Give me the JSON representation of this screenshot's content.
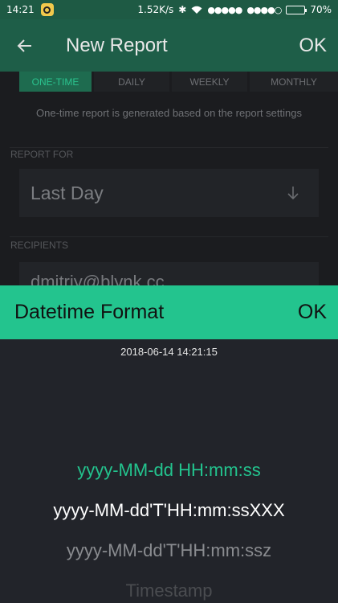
{
  "status_bar": {
    "time": "14:21",
    "speed": "1.52K/s",
    "signal_1": "●●●●●",
    "signal_2": "●●●●○",
    "battery": "70%",
    "battery_level": 0.7
  },
  "header": {
    "title": "New Report",
    "ok_label": "OK",
    "back_icon": "arrow-left-icon"
  },
  "report": {
    "tabs": [
      {
        "label": "ONE-TIME",
        "active": true
      },
      {
        "label": "DAILY",
        "active": false
      },
      {
        "label": "WEEKLY",
        "active": false
      },
      {
        "label": "MONTHLY",
        "active": false
      }
    ],
    "hint": "One-time report is generated based on the report settings",
    "report_for_label": "REPORT FOR",
    "report_for_value": "Last Day",
    "recipients_label": "RECIPIENTS",
    "recipient_value": "dmitriy@blynk.cc"
  },
  "dialog": {
    "title": "Datetime Format",
    "ok_label": "OK",
    "preview": "2018-06-14 14:21:15",
    "options": [
      {
        "label": "yyyy-MM-dd HH:mm:ss",
        "selected": true
      },
      {
        "label": "yyyy-MM-dd'T'HH:mm:ssXXX",
        "selected": false
      },
      {
        "label": "yyyy-MM-dd'T'HH:mm:ssz",
        "selected": false
      },
      {
        "label": "Timestamp",
        "selected": false
      }
    ]
  },
  "colors": {
    "accent": "#23c48e",
    "header_dimmed": "#1e5e48",
    "background": "#1b1c1f"
  }
}
